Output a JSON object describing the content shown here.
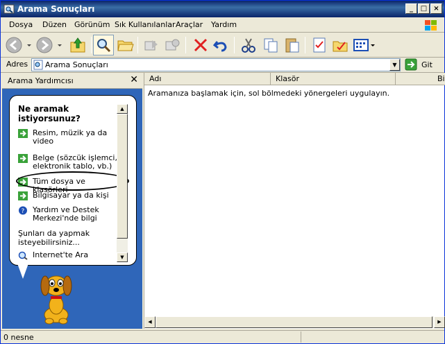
{
  "window": {
    "title": "Arama Sonuçları"
  },
  "menu": [
    "Dosya",
    "Düzen",
    "Görünüm",
    "Sık Kullanılanlar",
    "Araçlar",
    "Yardım"
  ],
  "address": {
    "label": "Adres",
    "value": "Arama Sonuçları",
    "go": "Git"
  },
  "left": {
    "title": "Arama Yardımcısı",
    "question": "Ne aramak istiyorsunuz?",
    "options": [
      "Resim, müzik ya da video",
      "Belge (sözcük işlemci, elektronik tablo, vb.)",
      "Tüm dosya ve klasörleri",
      "Bilgisayar ya da kişi",
      "Yardım ve Destek Merkezi'nde bilgi"
    ],
    "also": "Şunları da yapmak isteyebilirsiniz...",
    "internet": "Internet'te Ara"
  },
  "right": {
    "columns": [
      "Adı",
      "Klasör",
      "Bi"
    ],
    "message": "Aramanıza başlamak için, sol bölmedeki yönergeleri uygulayın."
  },
  "status": {
    "text": "0 nesne"
  }
}
